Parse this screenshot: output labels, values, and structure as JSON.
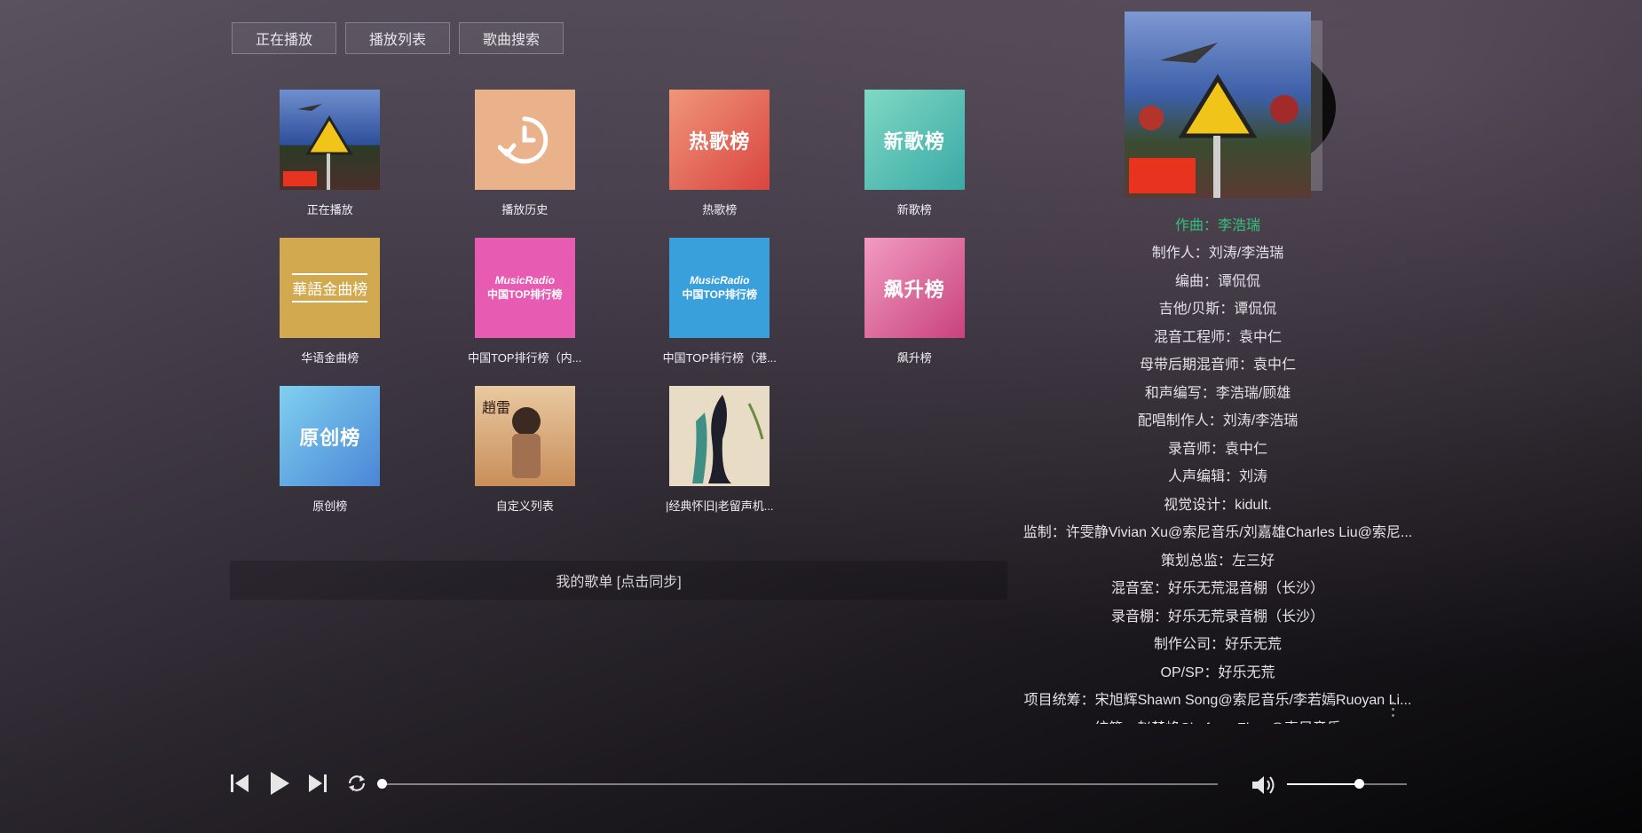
{
  "tabs": [
    "正在播放",
    "播放列表",
    "歌曲搜索"
  ],
  "cards": [
    {
      "label": "正在播放",
      "cover_text": ""
    },
    {
      "label": "播放历史",
      "cover_text": ""
    },
    {
      "label": "热歌榜",
      "cover_text": "热歌榜"
    },
    {
      "label": "新歌榜",
      "cover_text": "新歌榜"
    },
    {
      "label": "华语金曲榜",
      "cover_text": "華語金曲榜"
    },
    {
      "label": "中国TOP排行榜（内...",
      "cover_line1": "MusicRadio",
      "cover_line2": "中国TOP排行榜"
    },
    {
      "label": "中国TOP排行榜（港...",
      "cover_line1": "MusicRadio",
      "cover_line2": "中国TOP排行榜"
    },
    {
      "label": "飙升榜",
      "cover_text": "飙升榜"
    },
    {
      "label": "原创榜",
      "cover_text": "原创榜"
    },
    {
      "label": "自定义列表",
      "cover_text": ""
    },
    {
      "label": "|经典怀旧|老留声机...",
      "cover_text": ""
    }
  ],
  "sync": {
    "label": "我的歌单 [点击同步]"
  },
  "credits": [
    "作曲：李浩瑞",
    "制作人：刘涛/李浩瑞",
    "编曲：谭侃侃",
    "吉他/贝斯：谭侃侃",
    "混音工程师：袁中仁",
    "母带后期混音师：袁中仁",
    "和声编写：李浩瑞/顾雄",
    "配唱制作人：刘涛/李浩瑞",
    "录音师：袁中仁",
    "人声编辑：刘涛",
    "视觉设计：kidult.",
    "监制：许雯静Vivian Xu@索尼音乐/刘嘉雄Charles Liu@索尼...",
    "策划总监：左三好",
    "混音室：好乐无荒混音棚（长沙）",
    "录音棚：好乐无荒录音棚（长沙）",
    "制作公司：好乐无荒",
    "OP/SP：好乐无荒",
    "项目统筹：宋旭辉Shawn Song@索尼音乐/李若嫣Ruoyan Li...",
    "统筹：赵楚峰Chufeng Zhao@索尼音乐"
  ],
  "player": {
    "progress": 0.0,
    "volume": 0.6
  },
  "colors": {
    "highlight": "#31c27c"
  }
}
